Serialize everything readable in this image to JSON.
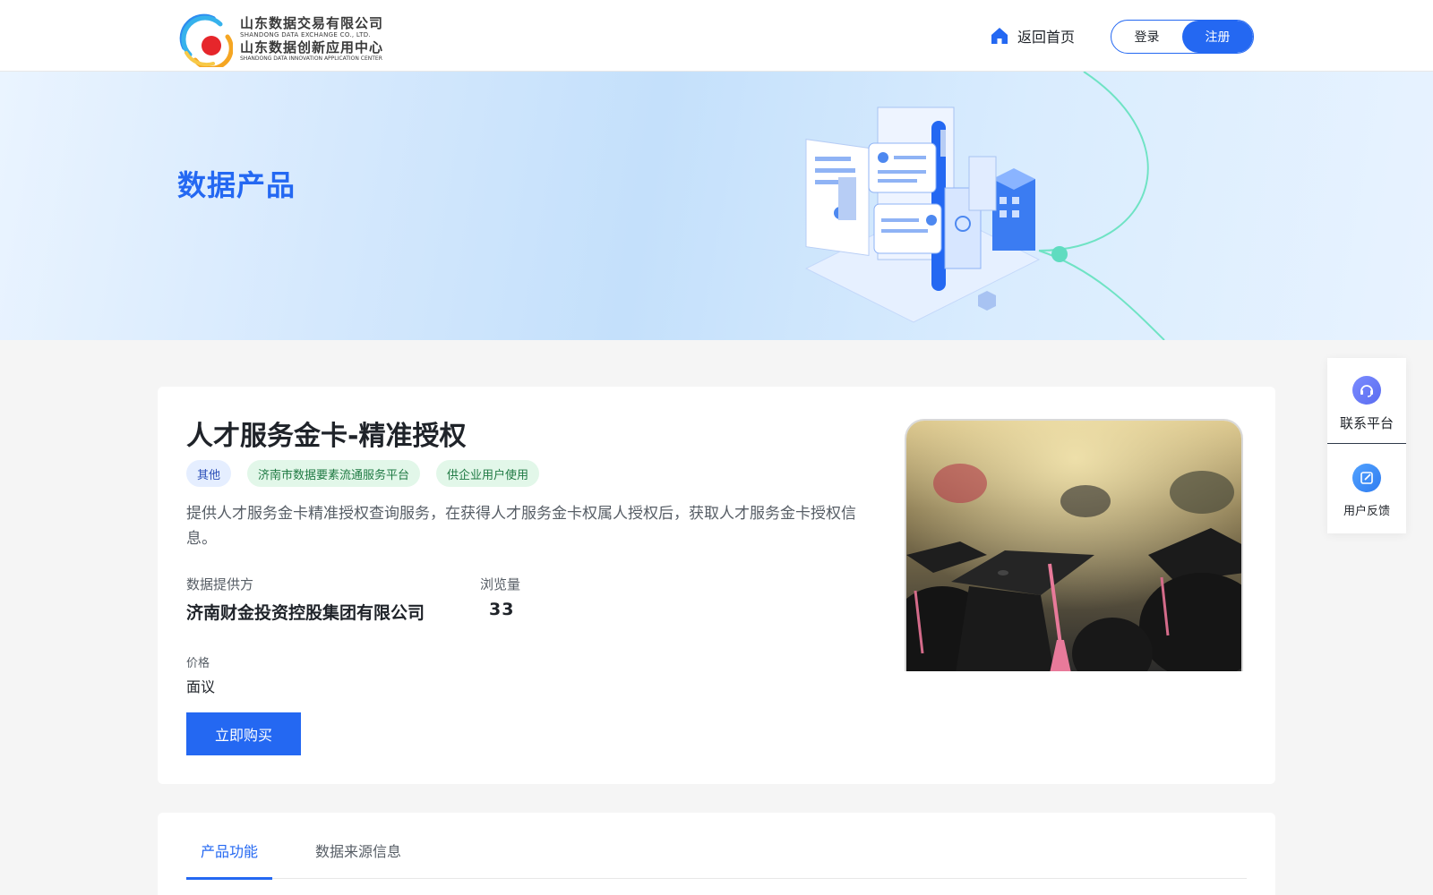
{
  "header": {
    "logo": {
      "cn_line1": "山东数据交易有限公司",
      "en_line1": "SHANDONG DATA EXCHANGE CO., LTD.",
      "cn_line2": "山东数据创新应用中心",
      "en_line2": "SHANDONG DATA INNOVATION APPLICATION CENTER"
    },
    "home_label": "返回首页",
    "login_label": "登录",
    "register_label": "注册"
  },
  "banner": {
    "title": "数据产品"
  },
  "product": {
    "title": "人才服务金卡-精准授权",
    "tags": [
      "其他",
      "济南市数据要素流通服务平台",
      "供企业用户使用"
    ],
    "description": "提供人才服务金卡精准授权查询服务，在获得人才服务金卡权属人授权后，获取人才服务金卡授权信息。",
    "provider_label": "数据提供方",
    "provider_value": "济南财金投资控股集团有限公司",
    "views_label": "浏览量",
    "views_value": "33",
    "price_label": "价格",
    "price_value": "面议",
    "buy_label": "立即购买"
  },
  "tabs": {
    "active": "产品功能",
    "inactive": "数据来源信息"
  },
  "side_panel": {
    "contact_label": "联系平台",
    "feedback_label": "用户反馈"
  },
  "colors": {
    "primary": "#2468f2",
    "tag_blue_bg": "#e5eeff",
    "tag_green_bg": "#e2f7e9",
    "page_bg": "#f5f5f5"
  },
  "icons": {
    "logo": "logo-icon",
    "home": "home-icon",
    "contact": "headset-icon",
    "feedback": "edit-icon"
  }
}
